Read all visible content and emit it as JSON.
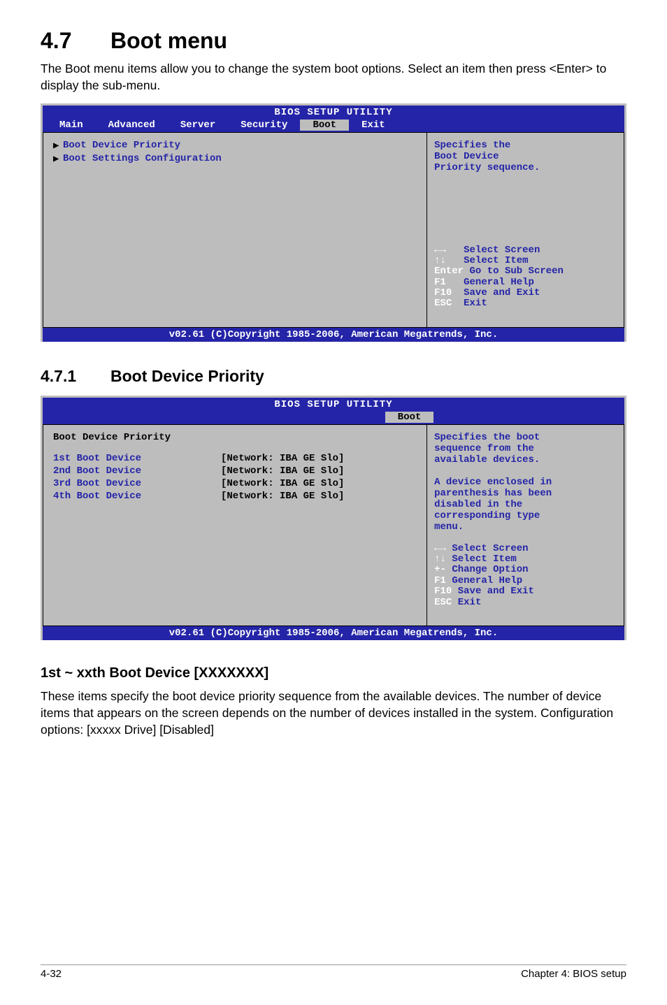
{
  "heading": {
    "num": "4.7",
    "title": "Boot menu"
  },
  "intro": "The Boot menu items allow you to change the system boot options. Select an item then press <Enter> to display the sub-menu.",
  "bios1": {
    "title": "BIOS SETUP UTILITY",
    "tabs": [
      "Main",
      "Advanced",
      "Server",
      "Security",
      "Boot",
      "Exit"
    ],
    "active_tab_index": 4,
    "left": {
      "items": [
        "Boot Device Priority",
        "Boot Settings Configuration"
      ]
    },
    "right": {
      "help": "Specifies the\nBoot Device\nPriority sequence.",
      "nav": [
        {
          "key": "←→",
          "desc": "Select Screen"
        },
        {
          "key": "↑↓",
          "desc": "Select Item"
        },
        {
          "key": "Enter",
          "desc": "Go to Sub Screen"
        },
        {
          "key": "F1",
          "desc": "General Help"
        },
        {
          "key": "F10",
          "desc": "Save and Exit"
        },
        {
          "key": "ESC",
          "desc": "Exit"
        }
      ]
    },
    "footer": "v02.61 (C)Copyright 1985-2006, American Megatrends, Inc."
  },
  "sub": {
    "num": "4.7.1",
    "title": "Boot Device Priority"
  },
  "bios2": {
    "title": "BIOS SETUP UTILITY",
    "tab": "Boot",
    "left": {
      "heading": "Boot Device Priority",
      "rows": [
        {
          "label": "1st Boot Device",
          "value": "[Network: IBA GE Slo]"
        },
        {
          "label": "2nd Boot Device",
          "value": "[Network: IBA GE Slo]"
        },
        {
          "label": "3rd Boot Device",
          "value": "[Network: IBA GE Slo]"
        },
        {
          "label": "4th Boot Device",
          "value": "[Network: IBA GE Slo]"
        }
      ]
    },
    "right": {
      "help": "Specifies the boot\nsequence from the\navailable devices.\n\nA device enclosed in\nparenthesis has been\ndisabled in the\ncorresponding type\nmenu.",
      "nav": [
        {
          "key": "←→",
          "desc": "Select Screen"
        },
        {
          "key": "↑↓",
          "desc": "Select Item"
        },
        {
          "key": "+-",
          "desc": "Change Option"
        },
        {
          "key": "F1",
          "desc": "General Help"
        },
        {
          "key": "F10",
          "desc": "Save and Exit"
        },
        {
          "key": "ESC",
          "desc": "Exit"
        }
      ]
    },
    "footer": "v02.61 (C)Copyright 1985-2006, American Megatrends, Inc."
  },
  "opt_heading": "1st ~ xxth Boot Device [XXXXXXX]",
  "opt_body": "These items specify the boot device priority sequence from the available devices. The number of device items that appears on the screen depends on the number of devices installed in the system. Configuration options: [xxxxx Drive] [Disabled]",
  "footer": {
    "left": "4-32",
    "right": "Chapter 4: BIOS setup"
  }
}
